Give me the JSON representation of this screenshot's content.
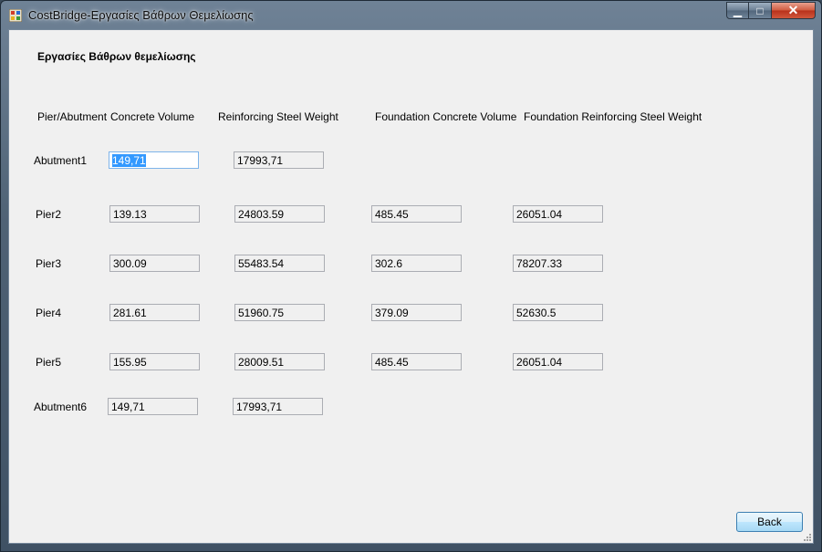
{
  "window": {
    "title": "CostBridge-Εργασίες Βάθρων Θεμελίωσης",
    "controls": {
      "minimize": "▁",
      "maximize": "□",
      "close": "✕"
    }
  },
  "form": {
    "heading": "Εργασίες Βάθρων θεμελίωσης",
    "columns": {
      "pier": "Pier/Abutment",
      "concrete": "Concrete Volume",
      "steel": "Reinforcing Steel Weight",
      "found_concrete": "Foundation Concrete Volume",
      "found_steel": "Foundation Reinforcing Steel Weight"
    },
    "rows": [
      {
        "label": "Abutment1",
        "concrete": "149,71",
        "steel": "17993,71"
      },
      {
        "label": "Pier2",
        "concrete": "139.13",
        "steel": "24803.59",
        "found_concrete": "485.45",
        "found_steel": "26051.04"
      },
      {
        "label": "Pier3",
        "concrete": "300.09",
        "steel": "55483.54",
        "found_concrete": "302.6",
        "found_steel": "78207.33"
      },
      {
        "label": "Pier4",
        "concrete": "281.61",
        "steel": "51960.75",
        "found_concrete": "379.09",
        "found_steel": "52630.5"
      },
      {
        "label": "Pier5",
        "concrete": "155.95",
        "steel": "28009.51",
        "found_concrete": "485.45",
        "found_steel": "26051.04"
      },
      {
        "label": "Abutment6",
        "concrete": "149,71",
        "steel": "17993,71"
      }
    ],
    "back_label": "Back"
  }
}
